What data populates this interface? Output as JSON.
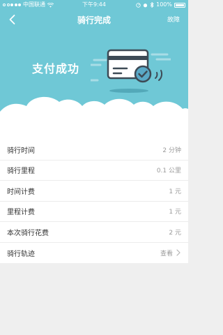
{
  "status_bar": {
    "carrier": "中国联通",
    "time": "下午9:44",
    "battery": "100%"
  },
  "nav": {
    "title": "骑行完成",
    "fault_label": "故障"
  },
  "hero": {
    "headline": "支付成功"
  },
  "rows": [
    {
      "label": "骑行时间",
      "value": "2 分钟"
    },
    {
      "label": "骑行里程",
      "value": "0.1 公里"
    },
    {
      "label": "时间计费",
      "value": "1 元"
    },
    {
      "label": "里程计费",
      "value": "1 元"
    },
    {
      "label": "本次骑行花费",
      "value": "2 元"
    },
    {
      "label": "骑行轨迹",
      "value": "查看"
    }
  ],
  "colors": {
    "accent": "#6fc8d6",
    "card_border": "#3d4a55",
    "check_circle": "#5aa9c7"
  },
  "icons": {
    "back": "back-arrow-icon",
    "card": "credit-card-icon",
    "check": "check-circle-icon",
    "chevron": "chevron-right-icon",
    "wifi": "wifi-icon",
    "alarm": "alarm-icon",
    "bluetooth": "bluetooth-icon",
    "location": "location-icon"
  }
}
